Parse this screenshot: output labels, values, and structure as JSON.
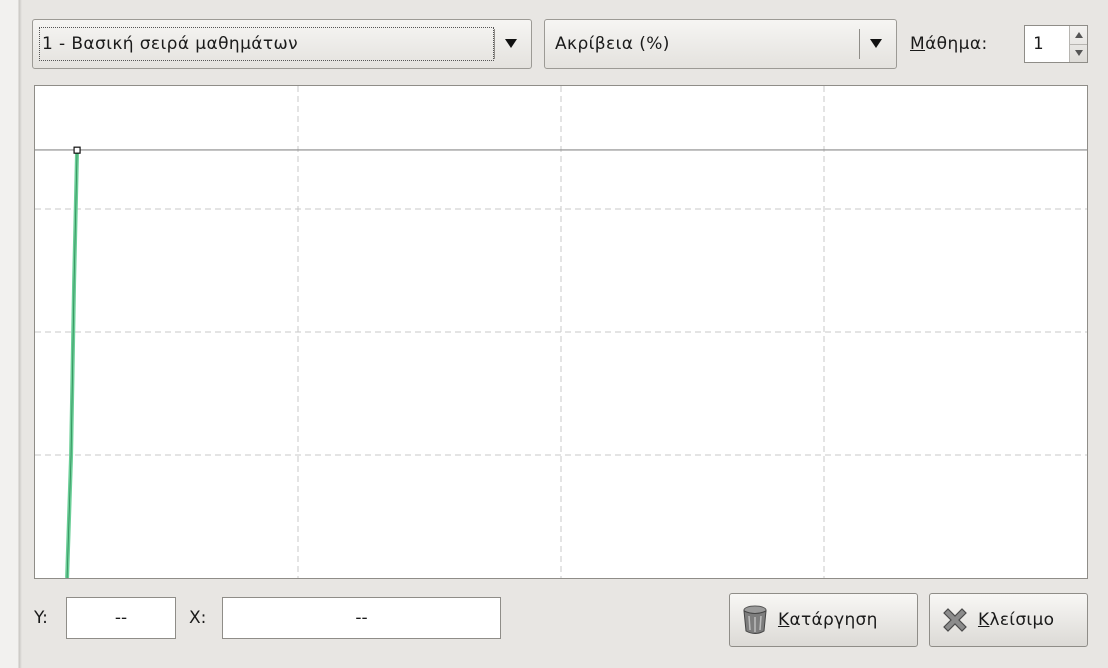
{
  "series_select": {
    "value": "1 - Βασική σειρά μαθημάτων"
  },
  "metric_select": {
    "value": "Ακρίβεια (%)"
  },
  "lesson": {
    "mnemonic": "Μ",
    "label_rest": "άθημα:",
    "value": "1"
  },
  "readouts": {
    "y_label": "Y:",
    "y_value": "--",
    "x_label": "X:",
    "x_value": "--"
  },
  "buttons": {
    "clear": {
      "mnemonic": "Κ",
      "rest": "ατάργηση"
    },
    "close": {
      "mnemonic": "Κ",
      "rest": "λείσιμο"
    }
  },
  "icons": {
    "clear": "trash-can-icon",
    "close": "close-x-icon",
    "combo_arrow": "triangle-down-icon"
  },
  "colors": {
    "series_line": "#6ccf98",
    "grid": "#c8c8c8",
    "reference_line": "#8a8a8a"
  },
  "chart_data": {
    "type": "line",
    "series": [
      {
        "values": [
          [
            1,
            100
          ]
        ]
      }
    ],
    "reference_line": true,
    "grid": true
  }
}
